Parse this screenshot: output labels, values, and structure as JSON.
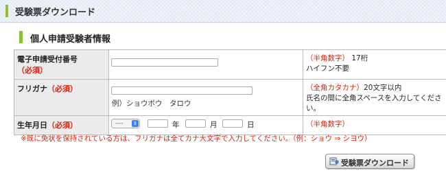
{
  "header": {
    "title": "受験票ダウンロード"
  },
  "section": {
    "title": "個人申請受験者情報"
  },
  "rows": [
    {
      "label": "電子申請受付番号",
      "required": "（必須）",
      "note_tag": "（半角数字）",
      "note_text": "17桁",
      "note_text2": "ハイフン不要"
    },
    {
      "label": "フリガナ",
      "required": "（必須）",
      "note_tag": "（全角カタカナ）",
      "note_text": "20文字以内",
      "note_text2": "氏名の間に全角スペースを入力してください。",
      "example": "例）ショウボウ　タロウ"
    },
    {
      "label": "生年月日",
      "required": "（必須）",
      "note_tag": "（半角数字）",
      "era_select": "----",
      "year_unit": "年",
      "month_unit": "月",
      "day_unit": "日"
    }
  ],
  "footnote": "※既に免状を保持されている方は、フリガナは全てカナ大文字で入力してください。（例：ショウ ⇒ シヨウ）",
  "download_button": {
    "label": "受験票ダウンロード",
    "icon": "download-icon"
  },
  "colors": {
    "required": "#d6220f",
    "accent_bar": "#8fbf3a",
    "header_bg": "#e3e8f1"
  }
}
